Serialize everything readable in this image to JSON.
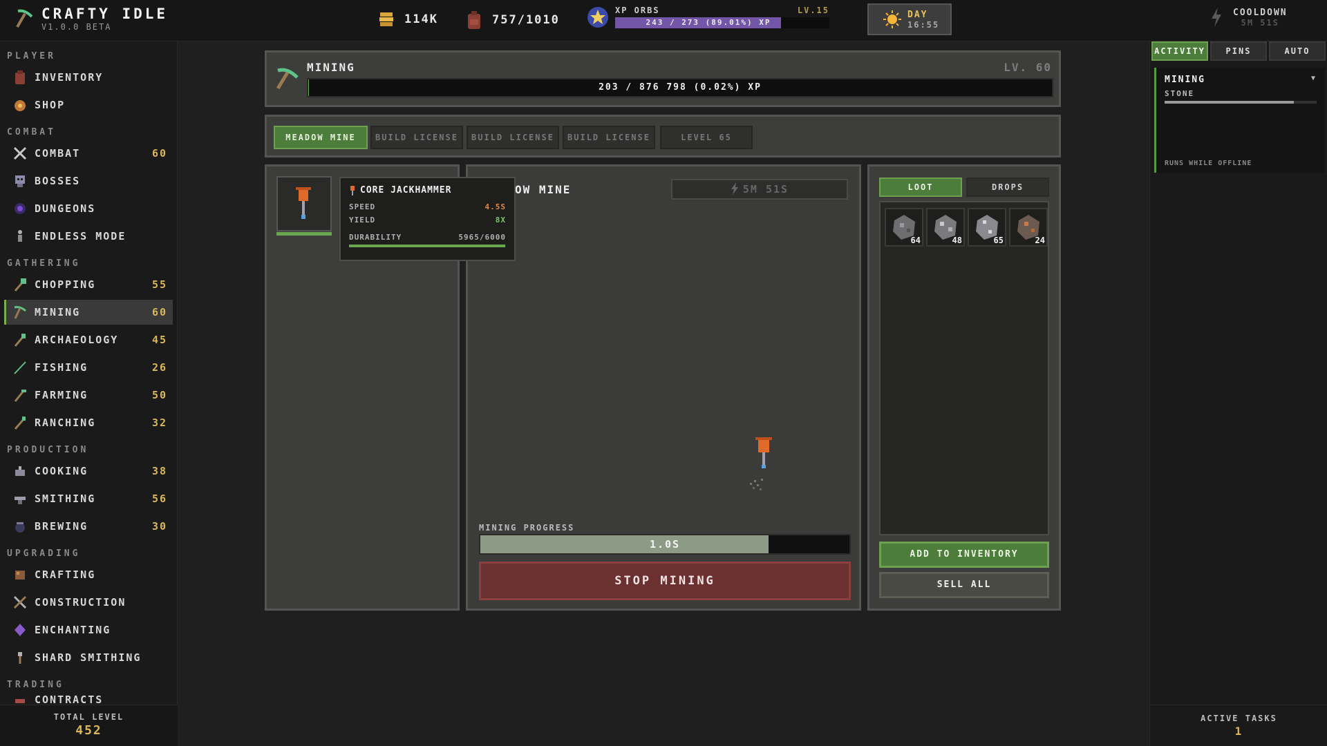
{
  "app": {
    "title": "CRAFTY IDLE",
    "version": "V1.0.0 BETA"
  },
  "header": {
    "gold": "114K",
    "inventory": "757/1010",
    "xp_orbs": {
      "label": "XP ORBS",
      "level": "LV.15",
      "progress_text": "243 / 273 (89.01%) XP",
      "fill_fraction": 0.89
    },
    "day": {
      "label": "DAY",
      "time": "16:55"
    },
    "cooldown": {
      "label": "COOLDOWN",
      "time": "5M 51S"
    }
  },
  "sidebar": {
    "sections": [
      {
        "title": "PLAYER"
      },
      {
        "title": "COMBAT"
      },
      {
        "title": "GATHERING"
      },
      {
        "title": "PRODUCTION"
      },
      {
        "title": "UPGRADING"
      },
      {
        "title": "TRADING"
      }
    ],
    "items": [
      {
        "label": "INVENTORY",
        "level": ""
      },
      {
        "label": "SHOP",
        "level": ""
      },
      {
        "label": "COMBAT",
        "level": "60"
      },
      {
        "label": "BOSSES",
        "level": ""
      },
      {
        "label": "DUNGEONS",
        "level": ""
      },
      {
        "label": "ENDLESS MODE",
        "level": ""
      },
      {
        "label": "CHOPPING",
        "level": "55"
      },
      {
        "label": "MINING",
        "level": "60"
      },
      {
        "label": "ARCHAEOLOGY",
        "level": "45"
      },
      {
        "label": "FISHING",
        "level": "26"
      },
      {
        "label": "FARMING",
        "level": "50"
      },
      {
        "label": "RANCHING",
        "level": "32"
      },
      {
        "label": "COOKING",
        "level": "38"
      },
      {
        "label": "SMITHING",
        "level": "56"
      },
      {
        "label": "BREWING",
        "level": "30"
      },
      {
        "label": "CRAFTING",
        "level": ""
      },
      {
        "label": "CONSTRUCTION",
        "level": ""
      },
      {
        "label": "ENCHANTING",
        "level": ""
      },
      {
        "label": "SHARD SMITHING",
        "level": ""
      },
      {
        "label": "CONTRACTS",
        "level": ""
      }
    ],
    "total_level_label": "TOTAL LEVEL",
    "total_level": "452"
  },
  "skill": {
    "name": "MINING",
    "level": "LV. 60",
    "xp_text": "203 / 876 798 (0.02%) XP",
    "xp_fraction": 0.0002
  },
  "areas": [
    {
      "label": "MEADOW MINE"
    },
    {
      "label": "BUILD LICENSE"
    },
    {
      "label": "BUILD LICENSE"
    },
    {
      "label": "BUILD LICENSE"
    },
    {
      "label": "LEVEL 65"
    }
  ],
  "tool": {
    "name": "CORE JACKHAMMER",
    "speed_label": "SPEED",
    "speed": "4.5S",
    "yield_label": "YIELD",
    "yield": "8X",
    "durability_label": "DURABILITY",
    "durability": "5965/6000",
    "durability_fraction": 0.994
  },
  "mine": {
    "title": "OW MINE",
    "cooldown": "5M 51S",
    "progress_label": "MINING PROGRESS",
    "progress_text": "1.0S",
    "progress_fraction": 0.78,
    "stop_label": "STOP MINING"
  },
  "loot": {
    "tabs": [
      "LOOT",
      "DROPS"
    ],
    "items": [
      {
        "icon": "stone-ore-icon",
        "count": "64"
      },
      {
        "icon": "iron-ore-icon",
        "count": "48"
      },
      {
        "icon": "silver-ore-icon",
        "count": "65"
      },
      {
        "icon": "copper-ore-icon",
        "count": "24"
      }
    ],
    "add_label": "ADD TO INVENTORY",
    "sell_label": "SELL ALL"
  },
  "right": {
    "tabs": [
      "ACTIVITY",
      "PINS",
      "AUTO"
    ],
    "task": {
      "title": "MINING",
      "subtitle": "STONE",
      "offline": "RUNS WHILE OFFLINE",
      "fill_fraction": 0.85
    },
    "active_label": "ACTIVE TASKS",
    "active_count": "1"
  },
  "colors": {
    "accent": "#6aa84f",
    "danger": "#6b3030",
    "gold": "#d9b75a",
    "xp": "#7356a8"
  }
}
